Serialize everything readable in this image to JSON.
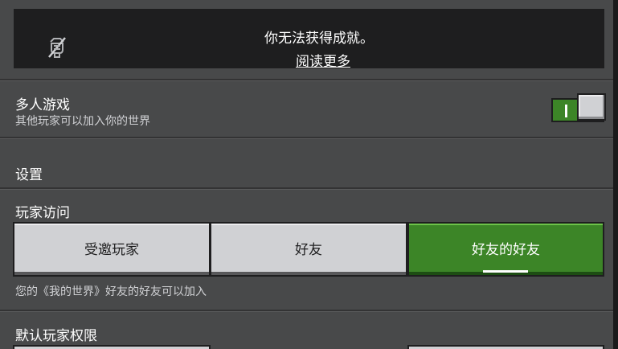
{
  "notice": {
    "message": "你无法获得成就。",
    "link_label": "阅读更多",
    "icon": "achievement-disabled-icon"
  },
  "multiplayer": {
    "title": "多人游戏",
    "subtitle": "其他玩家可以加入你的世界",
    "enabled": true,
    "toggle_mark": "I"
  },
  "settings": {
    "section_title": "设置"
  },
  "player_access": {
    "title": "玩家访问",
    "options": [
      {
        "label": "受邀玩家",
        "selected": false
      },
      {
        "label": "好友",
        "selected": false
      },
      {
        "label": "好友的好友",
        "selected": true
      }
    ],
    "description": "您的《我的世界》好友的好友可以加入"
  },
  "default_permissions": {
    "title": "默认玩家权限"
  },
  "colors": {
    "background": "#48494a",
    "panel_dark": "#1e1e1f",
    "accent_green": "#3c8527",
    "button_gray": "#d0d1d4"
  }
}
